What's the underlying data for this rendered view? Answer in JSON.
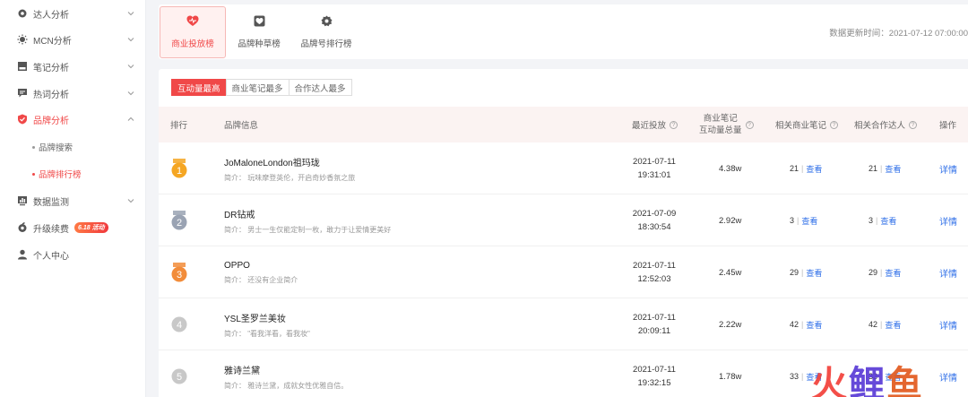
{
  "sidebar": {
    "items": [
      {
        "label": "达人分析",
        "icon": "gear-icon",
        "expanded": false
      },
      {
        "label": "MCN分析",
        "icon": "sun-icon",
        "expanded": false
      },
      {
        "label": "笔记分析",
        "icon": "note-icon",
        "expanded": false
      },
      {
        "label": "热词分析",
        "icon": "chat-icon",
        "expanded": false
      },
      {
        "label": "品牌分析",
        "icon": "shield-icon",
        "expanded": true
      },
      {
        "label": "数据监测",
        "icon": "monitor-icon",
        "expanded": false
      },
      {
        "label": "升级续费",
        "icon": "renew-icon",
        "badge": "6.18",
        "badge_suffix": "活动"
      },
      {
        "label": "个人中心",
        "icon": "user-icon"
      }
    ],
    "sub_items": [
      {
        "label": "品牌搜索"
      },
      {
        "label": "品牌排行榜"
      }
    ]
  },
  "tabs": [
    {
      "label": "商业投放榜",
      "icon": "heart-icon"
    },
    {
      "label": "品牌种草榜",
      "icon": "heart-box-icon"
    },
    {
      "label": "品牌号排行榜",
      "icon": "cog-icon"
    }
  ],
  "update_time": "数据更新时间：2021-07-12 07:00:00",
  "filters": [
    "互动量最高",
    "商业笔记最多",
    "合作达人最多"
  ],
  "columns": {
    "rank": "排行",
    "brand": "品牌信息",
    "recent": "最近投放",
    "engagement_l1": "商业笔记",
    "engagement_l2": "互动量总量",
    "notes": "相关商业笔记",
    "creators": "相关合作达人",
    "ops": "操作",
    "help_glyph": "?"
  },
  "view_label": "查看",
  "detail_label": "详情",
  "rows": [
    {
      "rank": "1",
      "name": "JoMaloneLondon祖玛珑",
      "desc": "简介：  玩味摩登英伦，开启奇妙香氛之旅",
      "date": "2021-07-11",
      "time": "19:31:01",
      "engagement": "4.38w",
      "notes": "21",
      "creators": "21"
    },
    {
      "rank": "2",
      "name": "DR钻戒",
      "desc": "简介：  男士一生仅能定制一枚，敢力于让爱情更美好",
      "date": "2021-07-09",
      "time": "18:30:54",
      "engagement": "2.92w",
      "notes": "3",
      "creators": "3"
    },
    {
      "rank": "3",
      "name": "OPPO",
      "desc": "简介：  还没有企业简介",
      "date": "2021-07-11",
      "time": "12:52:03",
      "engagement": "2.45w",
      "notes": "29",
      "creators": "29"
    },
    {
      "rank": "4",
      "name": "YSL圣罗兰美妆",
      "desc": "简介：  \"看我洋看，看我妆\"",
      "date": "2021-07-11",
      "time": "20:09:11",
      "engagement": "2.22w",
      "notes": "42",
      "creators": "42"
    },
    {
      "rank": "5",
      "name": "雅诗兰黛",
      "desc": "简介：  雅诗兰黛，成就女性优雅自信。",
      "date": "2021-07-11",
      "time": "19:32:15",
      "engagement": "1.78w",
      "notes": "33",
      "creators": "33"
    }
  ],
  "watermark": [
    "火",
    "鲤",
    "鱼"
  ],
  "colors": {
    "accent": "#f04848",
    "link": "#2f6fe8",
    "gold": "#f5a623",
    "silver": "#9aa3b3",
    "bronze": "#f28c3a",
    "gray": "#c8c8c8"
  }
}
